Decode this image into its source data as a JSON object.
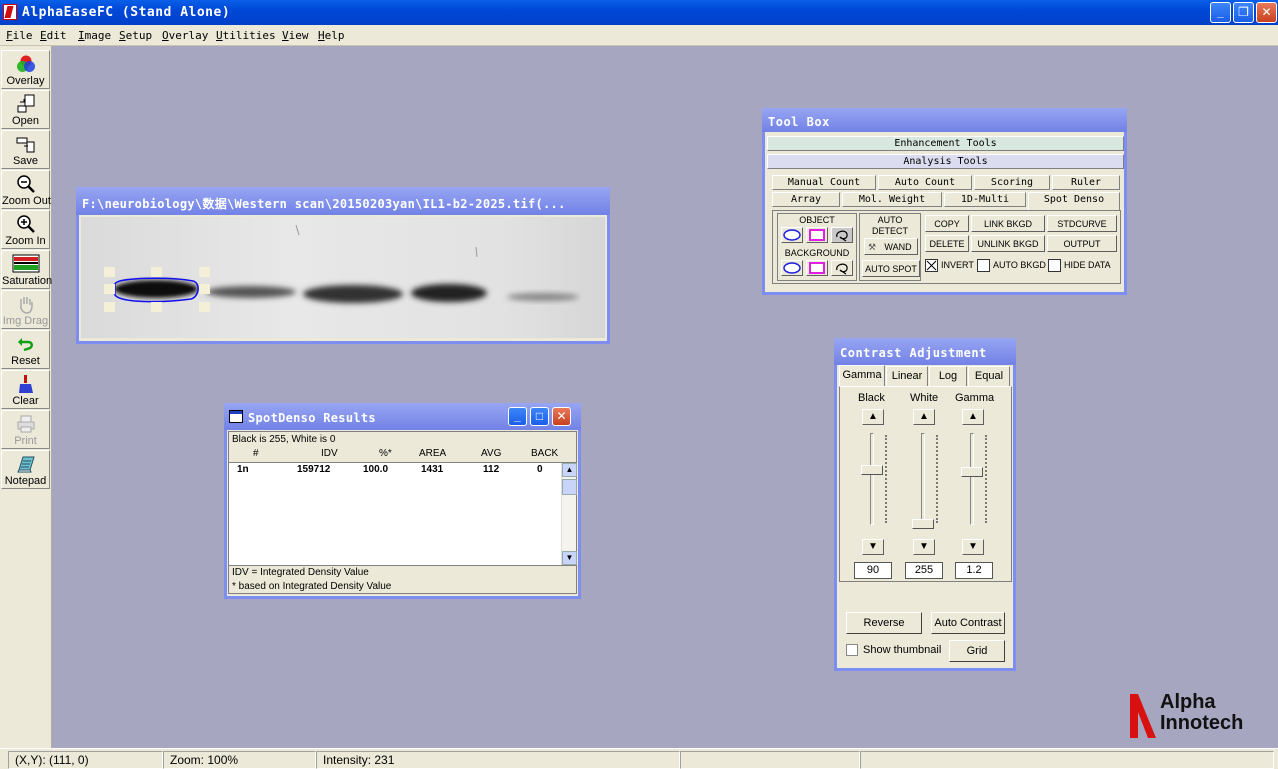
{
  "window": {
    "title": "AlphaEaseFC (Stand Alone)",
    "controls": [
      "_",
      "❐",
      "✕"
    ]
  },
  "menu": [
    "File",
    "Edit",
    "Image",
    "Setup",
    "Overlay",
    "Utilities",
    "View",
    "Help"
  ],
  "toolbar": [
    {
      "label": "Overlay",
      "icon": "overlay-icon",
      "enabled": true
    },
    {
      "label": "Open",
      "icon": "open-icon",
      "enabled": true
    },
    {
      "label": "Save",
      "icon": "save-icon",
      "enabled": true
    },
    {
      "label": "Zoom Out",
      "icon": "zoom-out-icon",
      "enabled": true
    },
    {
      "label": "Zoom In",
      "icon": "zoom-in-icon",
      "enabled": true
    },
    {
      "label": "Saturation",
      "icon": "saturation-icon",
      "enabled": true
    },
    {
      "label": "Img Drag",
      "icon": "hand-icon",
      "enabled": false
    },
    {
      "label": "Reset",
      "icon": "reset-icon",
      "enabled": true
    },
    {
      "label": "Clear",
      "icon": "clear-icon",
      "enabled": true
    },
    {
      "label": "Print",
      "icon": "print-icon",
      "enabled": false
    },
    {
      "label": "Notepad",
      "icon": "notepad-icon",
      "enabled": true
    }
  ],
  "image_window": {
    "title": "F:\\neurobiology\\数据\\Western scan\\20150203yan\\IL1-b2-2025.tif(..."
  },
  "toolbox": {
    "title": "Tool Box",
    "enhancement": "Enhancement Tools",
    "analysis": "Analysis Tools",
    "tabs_row1": [
      "Manual Count",
      "Auto Count",
      "Scoring",
      "Ruler"
    ],
    "tabs_row2": [
      "Array",
      "Mol. Weight",
      "1D-Multi",
      "Spot Denso"
    ],
    "object_label": "OBJECT",
    "background_label": "BACKGROUND",
    "auto_detect": "AUTO DETECT",
    "wand": "WAND",
    "auto_spot": "AUTO SPOT",
    "copy": "COPY",
    "link_bkgd": "LINK BKGD",
    "stdcurve": "STDCURVE",
    "delete": "DELETE",
    "unlink_bkgd": "UNLINK BKGD",
    "output": "OUTPUT",
    "invert": "INVERT",
    "auto_bkgd": "AUTO BKGD",
    "hide_data": "HIDE DATA"
  },
  "results": {
    "title": "SpotDenso Results",
    "header_note": "Black is 255, White is 0",
    "columns": [
      "#",
      "IDV",
      "%*",
      "AREA",
      "AVG",
      "BACK"
    ],
    "rows": [
      [
        "1n",
        "159712",
        "100.0",
        "1431",
        "112",
        "0"
      ]
    ],
    "footer1": "IDV = Integrated Density Value",
    "footer2": "* based on Integrated Density Value"
  },
  "contrast": {
    "title": "Contrast Adjustment",
    "tabs": [
      "Gamma",
      "Linear",
      "Log",
      "Equal"
    ],
    "channels": [
      "Black",
      "White",
      "Gamma"
    ],
    "values": [
      "90",
      "255",
      "1.2"
    ],
    "reverse": "Reverse",
    "auto_contrast": "Auto Contrast",
    "show_thumbnail": "Show thumbnail",
    "grid": "Grid"
  },
  "status": {
    "xy": "(X,Y): (111, 0)",
    "zoom": "Zoom: 100%",
    "intensity": "Intensity: 231"
  },
  "logo": {
    "line1": "Alpha",
    "line2": "Innotech"
  }
}
